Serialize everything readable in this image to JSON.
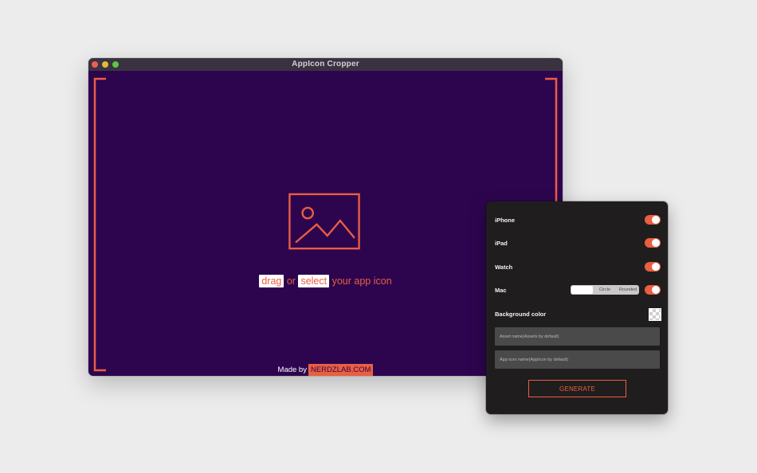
{
  "window": {
    "title": "AppIcon Cropper"
  },
  "dropzone": {
    "drag_label": "drag",
    "or_label": "or",
    "select_label": "select",
    "suffix": "your app icon",
    "icon": "image-placeholder-icon"
  },
  "footer": {
    "made_by": "Made by",
    "brand": "NERDZLAB.COM"
  },
  "options": {
    "iphone": {
      "label": "iPhone",
      "enabled": true
    },
    "ipad": {
      "label": "iPad",
      "enabled": true
    },
    "watch": {
      "label": "Watch",
      "enabled": true
    },
    "mac": {
      "label": "Mac",
      "enabled": true,
      "shape_options": [
        "",
        "Circle",
        "Rounded"
      ],
      "selected": 0
    },
    "background_color_label": "Background color"
  },
  "fields": {
    "asset_name_placeholder": "Asset name(Assets by default)",
    "app_icon_name_placeholder": "App icon name(AppIcon by default)"
  },
  "generate_label": "GENERATE",
  "colors": {
    "accent": "#ea5e41",
    "canvas": "#2d054f",
    "panel": "#1f1d1e",
    "field": "#4a4a4a"
  }
}
